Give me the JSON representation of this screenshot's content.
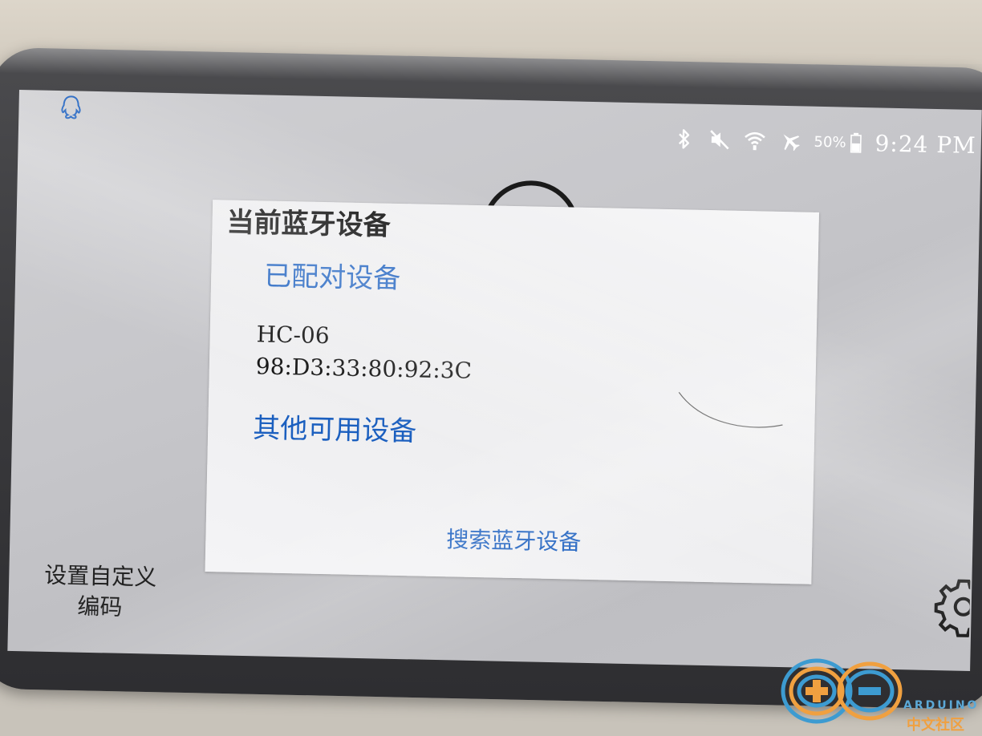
{
  "status_bar": {
    "battery": "50%",
    "time": "9:24 PM",
    "icons": [
      "qq-icon",
      "bluetooth-icon",
      "mute-icon",
      "wifi-icon",
      "airplane-icon",
      "battery-icon"
    ]
  },
  "dialog": {
    "title": "当前蓝牙设备",
    "paired_header": "已配对设备",
    "paired_devices": [
      {
        "name": "HC-06",
        "address": "98:D3:33:80:92:3C"
      }
    ],
    "other_header": "其他可用设备",
    "search_button": "搜索蓝牙设备"
  },
  "bottom": {
    "custom_code_line1": "设置自定义",
    "custom_code_line2": "编码",
    "settings_icon": "gear-icon"
  },
  "watermark": {
    "brand": "ARDUINO",
    "community": "中文社区"
  },
  "colors": {
    "accent": "#1b5fbf",
    "dialog_bg": "#f2f2f4",
    "screen_bg": "#c6c6ca"
  }
}
